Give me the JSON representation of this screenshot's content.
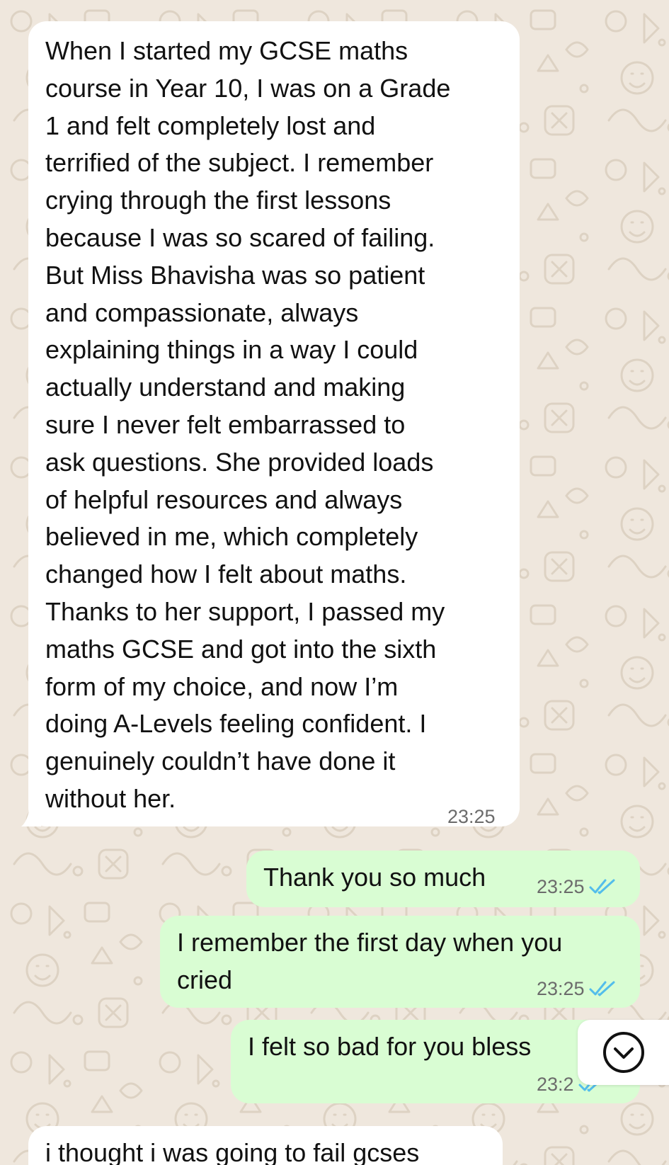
{
  "chat": {
    "messages": [
      {
        "direction": "incoming",
        "text": "When I started my GCSE maths\ncourse in Year 10, I was on a Grade\n1 and felt completely lost and\nterrified of the subject. I remember\ncrying through the first lessons\nbecause I was so scared of failing.\nBut Miss Bhavisha was so patient\nand compassionate, always\nexplaining things in a way I could\nactually understand and making\nsure I never felt embarrassed to\nask questions. She provided loads\nof helpful resources and always\nbelieved in me, which completely\nchanged how I felt about maths.\nThanks to her support, I passed my\nmaths GCSE and got into the sixth\nform of my choice, and now I’m\ndoing A-Levels feeling confident. I\ngenuinely couldn’t have done it\nwithout her.",
        "time": "23:25"
      },
      {
        "direction": "outgoing",
        "text": "Thank you so much",
        "time": "23:25",
        "status": "read"
      },
      {
        "direction": "outgoing",
        "text": "I remember the first day when you\ncried",
        "time": "23:25",
        "status": "read"
      },
      {
        "direction": "outgoing",
        "text": "I felt so bad for you bless",
        "time": "23:2",
        "status": "read"
      },
      {
        "direction": "incoming",
        "text": "i thought i was going to fail gcses"
      }
    ]
  },
  "colors": {
    "wallpaper": "#efe7dd",
    "incoming_bubble": "#ffffff",
    "outgoing_bubble": "#d9fdd3",
    "read_ticks": "#53bdeb",
    "timestamp": "#6b6b6b"
  },
  "icons": {
    "scroll_down": "chevron-down-circle-icon",
    "read_receipt": "double-check-icon"
  }
}
